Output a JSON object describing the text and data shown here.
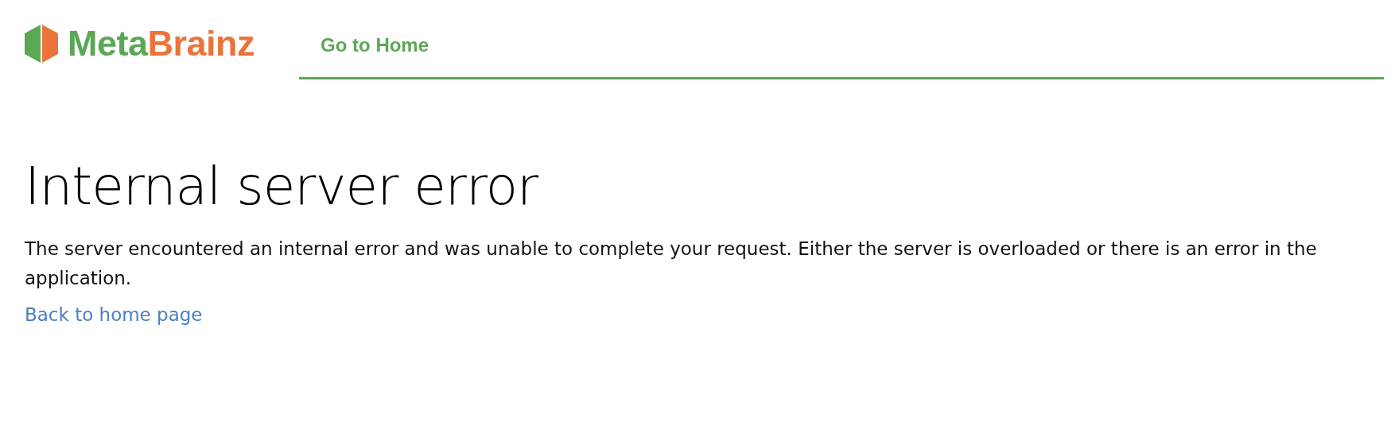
{
  "header": {
    "logo": {
      "first": "Meta",
      "second": "Brainz"
    },
    "nav_link": "Go to Home"
  },
  "heading": "Internal server error",
  "message": "The server encountered an internal error and was unable to complete your request. Either the server is overloaded or there is an error in the application.",
  "back_link": "Back to home page"
}
